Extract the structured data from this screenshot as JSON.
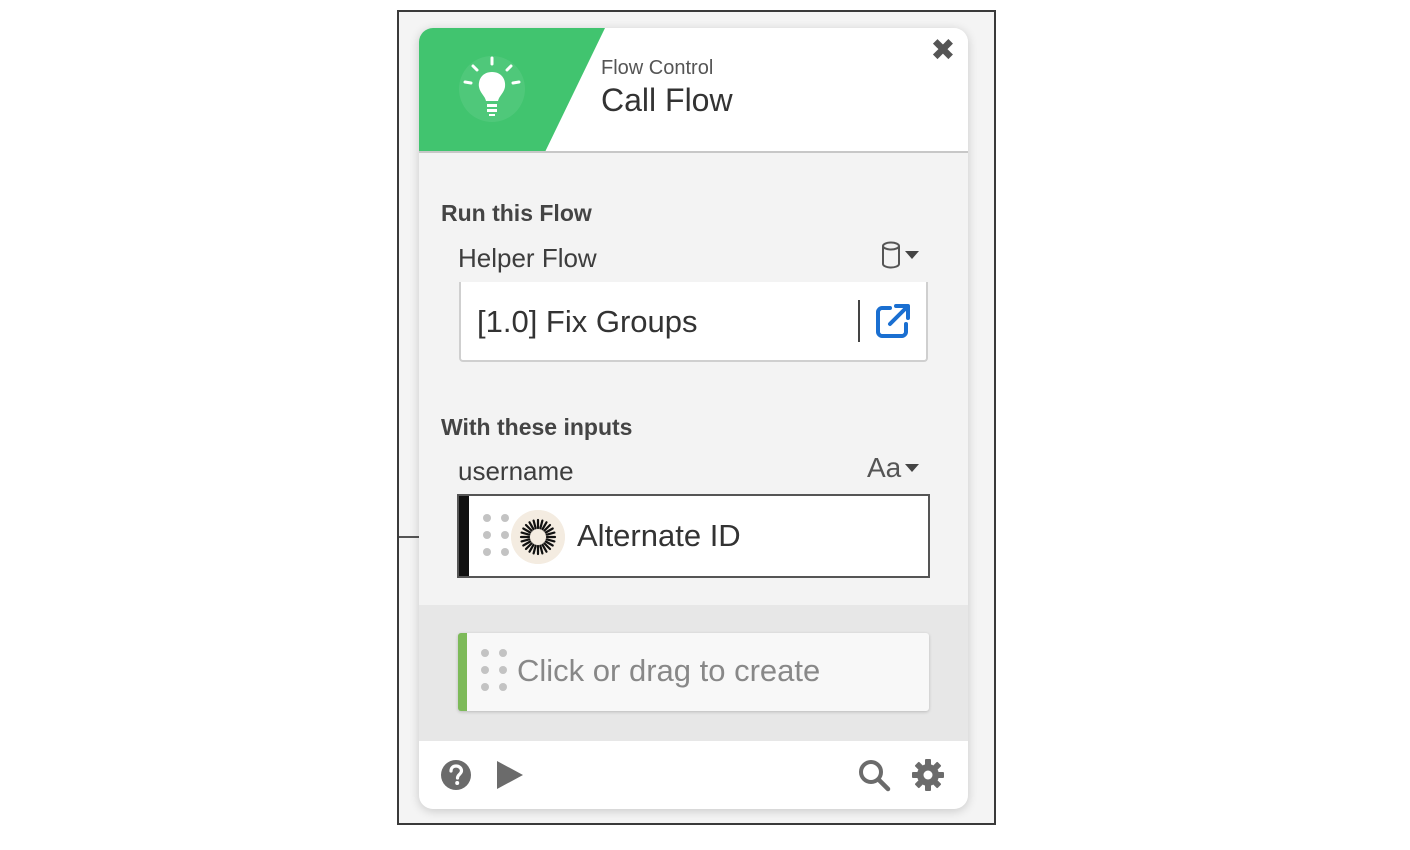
{
  "header": {
    "category": "Flow Control",
    "title": "Call Flow",
    "close_label": "✖",
    "accent_color": "#41c46f"
  },
  "run_section": {
    "heading": "Run this Flow",
    "field_label": "Helper Flow",
    "type_icon": "database-icon",
    "selected_flow": "[1.0] Fix Groups",
    "strip_colors": [
      "#5a9e2a",
      "#111111",
      "#e8912d",
      "#2ba3e6"
    ],
    "open_icon": "external-link-icon"
  },
  "inputs_section": {
    "heading": "With these inputs",
    "field_label": "username",
    "type_label": "Aa",
    "value": "Alternate ID",
    "value_icon": "sunburst-icon"
  },
  "create": {
    "placeholder": "Click or drag to create",
    "accent_color": "#7dba59"
  },
  "footer": {
    "left_icons": [
      "help-icon",
      "play-icon"
    ],
    "right_icons": [
      "search-icon",
      "gear-icon"
    ]
  }
}
